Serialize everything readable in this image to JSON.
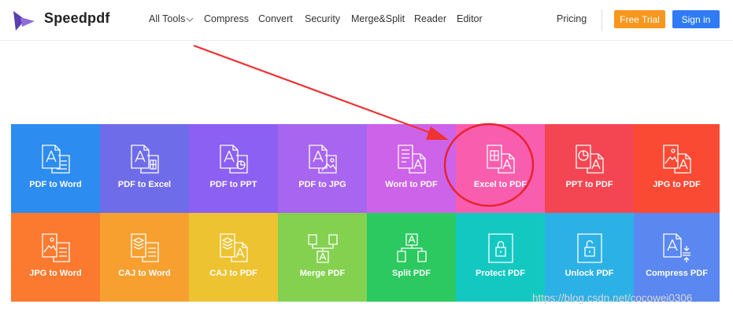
{
  "header": {
    "brand": "Speedpdf",
    "nav": [
      {
        "label": "All Tools",
        "name": "nav-all-tools",
        "has_dropdown": true
      },
      {
        "label": "Compress",
        "name": "nav-compress",
        "has_dropdown": false
      },
      {
        "label": "Convert",
        "name": "nav-convert",
        "has_dropdown": false
      },
      {
        "label": "Security",
        "name": "nav-security",
        "has_dropdown": false
      },
      {
        "label": "Merge&Split",
        "name": "nav-merge-split",
        "has_dropdown": false
      },
      {
        "label": "Reader",
        "name": "nav-reader",
        "has_dropdown": false
      },
      {
        "label": "Editor",
        "name": "nav-editor",
        "has_dropdown": false
      }
    ],
    "pricing": "Pricing",
    "free_trial": "Free Trial",
    "sign_in": "Sign in"
  },
  "tools": [
    {
      "label": "PDF to Word",
      "icon": "pdf-to-word-icon",
      "color": "#2d8cf0"
    },
    {
      "label": "PDF to Excel",
      "icon": "pdf-to-excel-icon",
      "color": "#6f6ce9"
    },
    {
      "label": "PDF to PPT",
      "icon": "pdf-to-ppt-icon",
      "color": "#8c60f2"
    },
    {
      "label": "PDF to JPG",
      "icon": "pdf-to-jpg-icon",
      "color": "#a865ef"
    },
    {
      "label": "Word to PDF",
      "icon": "word-to-pdf-icon",
      "color": "#cd63e9"
    },
    {
      "label": "Excel to PDF",
      "icon": "excel-to-pdf-icon",
      "color": "#f95eae"
    },
    {
      "label": "PPT to PDF",
      "icon": "ppt-to-pdf-icon",
      "color": "#f44652"
    },
    {
      "label": "JPG to PDF",
      "icon": "jpg-to-pdf-icon",
      "color": "#fa4a33"
    },
    {
      "label": "JPG to Word",
      "icon": "jpg-to-word-icon",
      "color": "#fb7a2f"
    },
    {
      "label": "CAJ to Word",
      "icon": "caj-to-word-icon",
      "color": "#f7a02f"
    },
    {
      "label": "CAJ to PDF",
      "icon": "caj-to-pdf-icon",
      "color": "#edc332"
    },
    {
      "label": "Merge PDF",
      "icon": "merge-pdf-icon",
      "color": "#84d150"
    },
    {
      "label": "Split PDF",
      "icon": "split-pdf-icon",
      "color": "#2bc95f"
    },
    {
      "label": "Protect PDF",
      "icon": "protect-pdf-icon",
      "color": "#14c8c2"
    },
    {
      "label": "Unlock PDF",
      "icon": "unlock-pdf-icon",
      "color": "#2cb1e6"
    },
    {
      "label": "Compress PDF",
      "icon": "compress-pdf-icon",
      "color": "#5a87f0"
    }
  ],
  "annotation": {
    "arrow_color": "#ee3333",
    "circle_color": "#e8232d"
  },
  "watermark": "https://blog.csdn.net/cocowei0306"
}
